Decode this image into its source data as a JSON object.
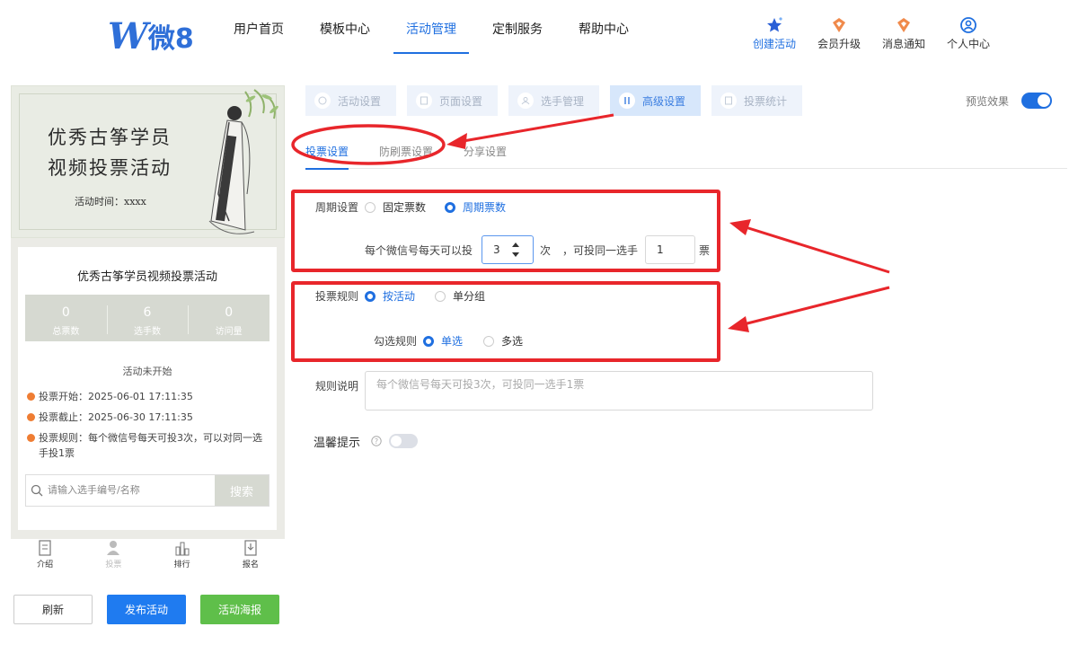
{
  "header": {
    "logo_text": "微8",
    "nav": [
      "用户首页",
      "模板中心",
      "活动管理",
      "定制服务",
      "帮助中心"
    ],
    "active_nav": "活动管理",
    "tools": [
      {
        "label": "创建活动",
        "icon": "star-icon"
      },
      {
        "label": "会员升级",
        "icon": "diamond-icon"
      },
      {
        "label": "消息通知",
        "icon": "bell-icon"
      },
      {
        "label": "个人中心",
        "icon": "user-icon"
      }
    ]
  },
  "preview": {
    "banner_line1": "优秀古筝学员",
    "banner_line2": "视频投票活动",
    "banner_time": "活动时间：xxxx",
    "card_title": "优秀古筝学员视频投票活动",
    "stats": [
      {
        "value": "0",
        "label": "总票数"
      },
      {
        "value": "6",
        "label": "选手数"
      },
      {
        "value": "0",
        "label": "访问量"
      }
    ],
    "status": "活动未开始",
    "info": [
      "投票开始：2025-06-01 17:11:35",
      "投票截止：2025-06-30 17:11:35",
      "投票规则：每个微信号每天可投3次，可以对同一选手投1票"
    ],
    "search_placeholder": "请输入选手编号/名称",
    "search_button": "搜索",
    "tabbar": [
      "介绍",
      "投票",
      "排行",
      "报名"
    ],
    "buttons": [
      "刷新",
      "发布活动",
      "活动海报"
    ]
  },
  "steps": [
    "活动设置",
    "页面设置",
    "选手管理",
    "高级设置",
    "投票统计"
  ],
  "active_step": "高级设置",
  "preview_toggle": "预览效果",
  "subtabs": [
    "投票设置",
    "防刷票设置",
    "分享设置"
  ],
  "form": {
    "period_label": "周期设置",
    "period_options": [
      "固定票数",
      "周期票数"
    ],
    "period_selected": "周期票数",
    "daily_prefix": "每个微信号每天可以投",
    "daily_value": "3",
    "daily_unit": "次",
    "same_prefix": "，可投同一选手",
    "same_value": "1",
    "same_unit": "票",
    "rule_label": "投票规则",
    "rule_options": [
      "按活动",
      "单分组"
    ],
    "rule_selected": "按活动",
    "check_label": "勾选规则",
    "check_options": [
      "单选",
      "多选"
    ],
    "check_selected": "单选",
    "desc_label": "规则说明",
    "desc_placeholder": "每个微信号每天可投3次，可投同一选手1票",
    "tip_label": "温馨提示",
    "tip_enabled": false
  },
  "colors": {
    "accent": "#1f6fe0",
    "annotation": "#e8262b",
    "green": "#5fbf4a"
  }
}
